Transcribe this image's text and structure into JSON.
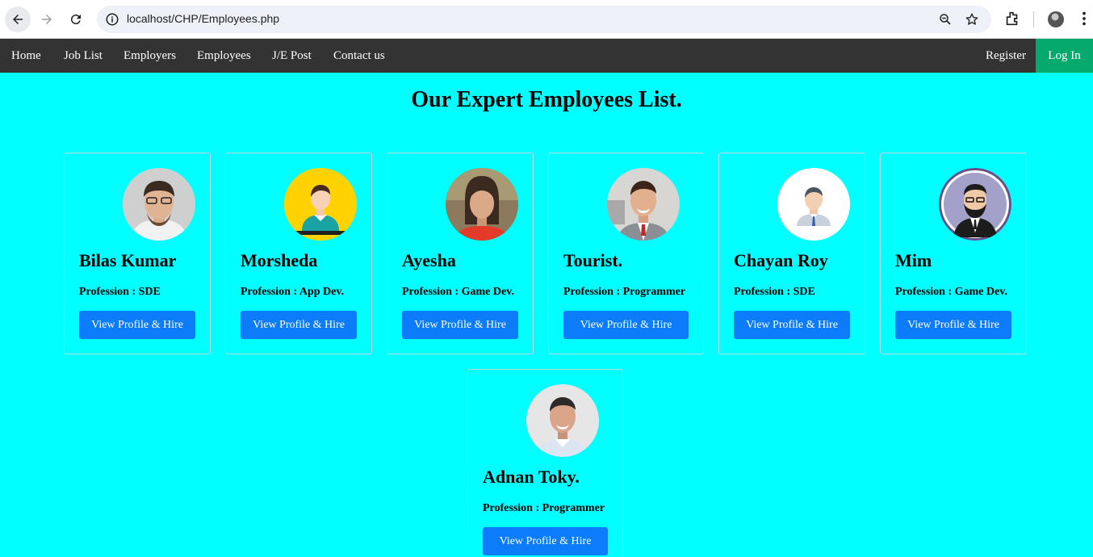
{
  "browser": {
    "url": "localhost/CHP/Employees.php"
  },
  "nav": {
    "links": [
      "Home",
      "Job List",
      "Employers",
      "Employees",
      "J/E Post",
      "Contact us"
    ],
    "register": "Register",
    "login": "Log In"
  },
  "page": {
    "title": "Our Expert Employees List."
  },
  "employees": [
    {
      "name": "Bilas Kumar",
      "profession": "Profession : SDE",
      "button": "View Profile & Hire",
      "avatar_icon": "man-glasses-photo-icon"
    },
    {
      "name": "Morsheda",
      "profession": "Profession : App Dev.",
      "button": "View Profile & Hire",
      "avatar_icon": "person-cartoon-yellow-icon"
    },
    {
      "name": "Ayesha",
      "profession": "Profession : Game Dev.",
      "button": "View Profile & Hire",
      "avatar_icon": "woman-photo-icon"
    },
    {
      "name": "Tourist.",
      "profession": "Profession : Programmer",
      "button": "View Profile & Hire",
      "avatar_icon": "man-suit-photo-icon"
    },
    {
      "name": "Chayan Roy",
      "profession": "Profession : SDE",
      "button": "View Profile & Hire",
      "avatar_icon": "businessman-cartoon-icon"
    },
    {
      "name": "Mim",
      "profession": "Profession : Game Dev.",
      "button": "View Profile & Hire",
      "avatar_icon": "bearded-man-cartoon-icon"
    },
    {
      "name": "Adnan Toky.",
      "profession": "Profession : Programmer",
      "button": "View Profile & Hire",
      "avatar_icon": "man-smiling-photo-icon"
    }
  ],
  "colors": {
    "background": "#00ffff",
    "navbar": "#333333",
    "login_accent": "#04aa6d",
    "button": "#0d7cfa"
  }
}
